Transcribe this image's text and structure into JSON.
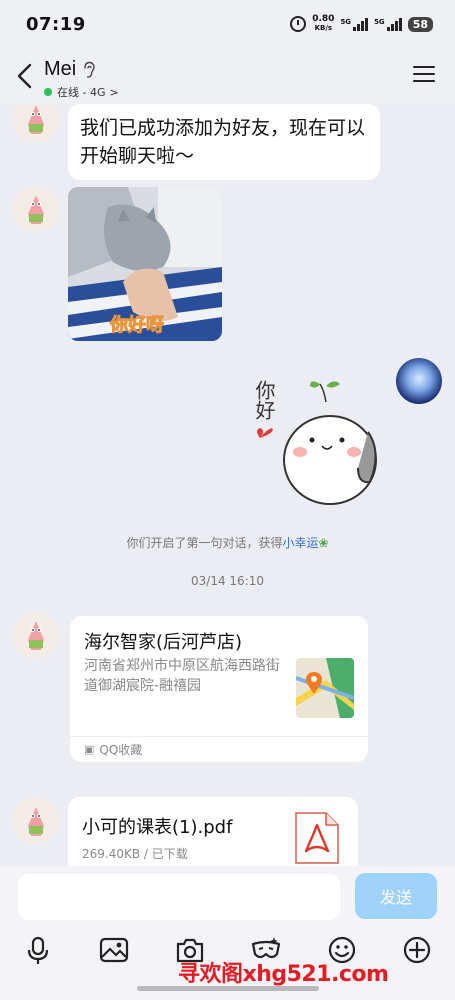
{
  "status_bar": {
    "time": "07:19",
    "net_speed_value": "0.80",
    "net_speed_unit": "KB/s",
    "signal1_label": "5G",
    "signal2_label": "5G",
    "battery": "58"
  },
  "header": {
    "contact_name": "Mei",
    "status": "在线 - 4G",
    "status_chevron": ">"
  },
  "messages": {
    "text1": "我们已成功添加为好友，现在可以开始聊天啦～",
    "photo_caption": "你好呀",
    "sticker_text": "你好",
    "system_notice_prefix": "你们开启了第一句对话，获得",
    "system_notice_link": "小幸运",
    "timestamp": "03/14 16:10",
    "location_title": "海尔智家(后河芦店)",
    "location_address": "河南省郑州市中原区航海西路街道御湖宸院-融禧园",
    "location_footer": "QQ收藏",
    "file_name": "小可的课表(1).pdf",
    "file_meta": "269.40KB / 已下载"
  },
  "input": {
    "placeholder": "",
    "send_label": "发送"
  },
  "watermark": "寻欢阁xhg521.com",
  "colors": {
    "background": "#ecedf2",
    "send_button": "#9ed2fb",
    "online_dot": "#25c35c",
    "link": "#2f6fd6",
    "watermark": "#e51c23"
  }
}
